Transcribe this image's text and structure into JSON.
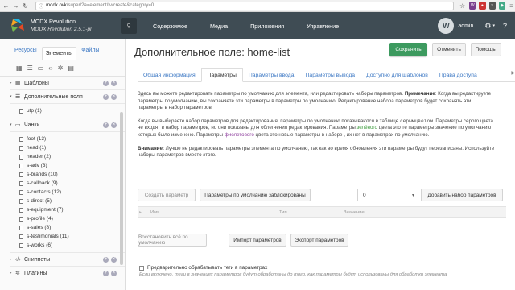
{
  "browser": {
    "url_domain": "modx.ovk",
    "url_path": "/super/?a=element/tv/create&category=0"
  },
  "topnav": {
    "logo_title": "MODX Revolution",
    "logo_version": "MODX Revolution 2.5.1-pl",
    "menu": [
      "Содержимое",
      "Медиа",
      "Приложения",
      "Управление"
    ],
    "user_initial": "W",
    "user_name": "admin"
  },
  "leftpanel": {
    "tabs": [
      "Ресурсы",
      "Элементы",
      "Файлы"
    ],
    "categories": [
      {
        "name": "Шаблоны",
        "expanded": false,
        "icon": "template-icon",
        "items": []
      },
      {
        "name": "Дополнительные поля",
        "expanded": true,
        "icon": "list-icon",
        "items": [
          "utp (1)"
        ]
      },
      {
        "name": "Чанки",
        "expanded": true,
        "icon": "chunk-icon",
        "items": [
          "foot (13)",
          "head (1)",
          "header (2)",
          "s-adv (3)",
          "s-brands (10)",
          "s-callback (9)",
          "s-contacts (12)",
          "s-direct (5)",
          "s-equipment (7)",
          "s-profile (4)",
          "s-sales (8)",
          "s-testimonials (11)",
          "s-works (6)"
        ]
      },
      {
        "name": "Сниппеты",
        "expanded": false,
        "icon": "code-icon",
        "items": []
      },
      {
        "name": "Плагины",
        "expanded": false,
        "icon": "plugin-icon",
        "items": []
      }
    ]
  },
  "main": {
    "title": "Дополнительное поле: home-list",
    "buttons": {
      "save": "Сохранить",
      "cancel": "Отменить",
      "help": "Помощь!"
    },
    "tabs": [
      "Общая информация",
      "Параметры",
      "Параметры ввода",
      "Параметры вывода",
      "Доступно для шаблонов",
      "Права доступа"
    ],
    "active_tab": 1,
    "p1_pre": "Здесь вы можете редактировать параметры по умолчанию для элемента, или редактировать наборы параметров.",
    "p1_bold": "Примечание",
    "p1_post": ": Когда вы редактируете параметры по умолчанию, вы сохраняете эти параметры в параметры по умолчанию. Редактирование набора параметров будет сохранять эти параметры в набор параметров.",
    "p2_a": "Когда вы выбираете набор параметров для редактирования, параметры по умолчанию показываются в таблице",
    "p2_mono": "серымцветом",
    "p2_b": ". Параметры серого цвета не входят в набор параметров, но они показаны для облегчения редактирования. Параметры",
    "p2_green": "зелёного",
    "p2_c": "цвета это те параметры значение по умолчанию которых было изменено. Параметры",
    "p2_purple": "фиолетового",
    "p2_d": "цвета это новые параметры в наборе , их нет в параметрах по умолчанию.",
    "p3_bold": "Внимание:",
    "p3_post": " Лучше не редактировать параметры элемента по умолчанию, так как во время обновления эти параметры будут перезаписаны. Используйте наборы параметров вместо этого.",
    "grid": {
      "create_param": "Создать параметр",
      "defaults_locked": "Параметры по умолчанию заблокированы",
      "set_value": "0",
      "add_set": "Добавить набор параметров",
      "col_name": "Имя",
      "col_type": "Тип",
      "col_value": "Значение",
      "restore_all": "Восстановить всё по умолчанию",
      "import": "Импорт параметров",
      "export": "Экспорт параметров"
    },
    "preprocess_label": "Предварительно обрабатывать теги в параметрах",
    "preprocess_hint": "Если включено, теги в значениях параметров будут обработаны до того, как параметры будут использованы для обработки элемента"
  }
}
